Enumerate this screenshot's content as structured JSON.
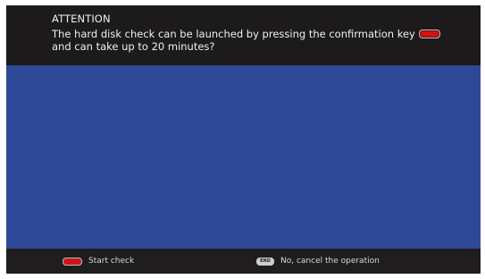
{
  "dialog": {
    "title": "ATTENTION",
    "message_line1": "The hard disk check can be launched by pressing the confirmation key",
    "message_line2": "and can take up to 20 minutes?"
  },
  "footer": {
    "start_label": "Start check",
    "end_key_label": "END",
    "cancel_label": "No, cancel the operation"
  },
  "colors": {
    "header_bg": "#1c1a1b",
    "content_bg": "#2e4997",
    "footer_bg": "#1f1d1e",
    "red_key": "#d01317"
  },
  "icons": {
    "confirm_key": "red-key-icon",
    "end_key": "end-key-icon"
  }
}
